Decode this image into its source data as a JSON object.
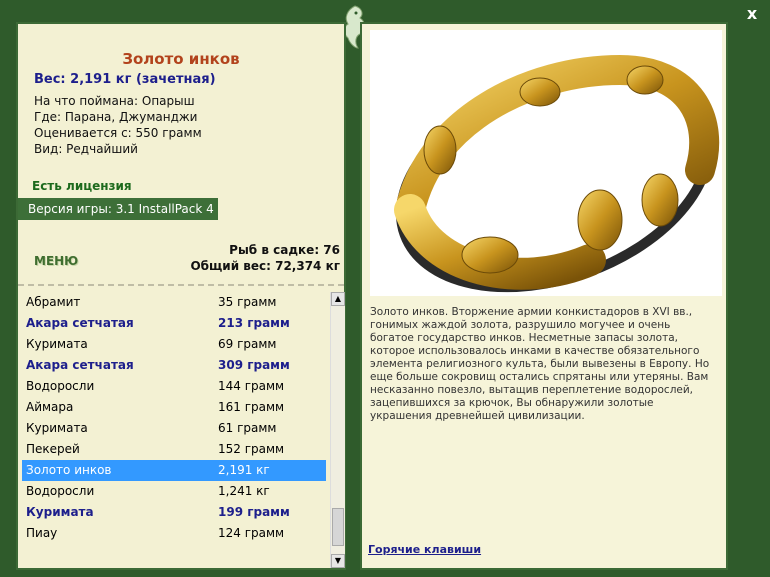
{
  "window": {
    "close_label": "x"
  },
  "fish": {
    "title": "Золото инков",
    "weight_line": "Вес: 2,191 кг (зачетная)",
    "caught_on": "На что поймана: Опарыш",
    "where": "Где: Парана, Джуманджи",
    "valued_from": "Оценивается с: 550 грамм",
    "kind": "Вид: Редчайший"
  },
  "license": "Есть лицензия",
  "version": "Версия игры: 3.1 InstallPack 4",
  "menu_label": "МЕНЮ",
  "stats": {
    "fish_in_keepnet": "Рыб в садке: 76",
    "total_weight": "Общий вес: 72,374 кг"
  },
  "catch_list": [
    {
      "name": "Абрамит",
      "weight": "35 грамм",
      "bold": false,
      "selected": false
    },
    {
      "name": "Акара сетчатая",
      "weight": "213 грамм",
      "bold": true,
      "selected": false
    },
    {
      "name": "Куримата",
      "weight": "69 грамм",
      "bold": false,
      "selected": false
    },
    {
      "name": "Акара сетчатая",
      "weight": "309 грамм",
      "bold": true,
      "selected": false
    },
    {
      "name": "Водоросли",
      "weight": "144 грамм",
      "bold": false,
      "selected": false
    },
    {
      "name": "Аймара",
      "weight": "161 грамм",
      "bold": false,
      "selected": false
    },
    {
      "name": "Куримата",
      "weight": "61 грамм",
      "bold": false,
      "selected": false
    },
    {
      "name": "Пекерей",
      "weight": "152 грамм",
      "bold": false,
      "selected": false
    },
    {
      "name": "Золото инков",
      "weight": "2,191 кг",
      "bold": false,
      "selected": true
    },
    {
      "name": "Водоросли",
      "weight": "1,241 кг",
      "bold": false,
      "selected": false
    },
    {
      "name": "Куримата",
      "weight": "199 грамм",
      "bold": true,
      "selected": false
    },
    {
      "name": "Пиау",
      "weight": "124 грамм",
      "bold": false,
      "selected": false
    }
  ],
  "description": "Золото инков. Вторжение армии конкистадоров в XVI вв., гонимых жаждой золота, разрушило могучее и очень богатое государство инков. Несметные запасы золота, которое использовалось инками в качестве обязательного элемента религиозного культа, были вывезены в Европу. Но еще больше сокровищ остались спрятаны или утеряны. Вам несказанно повезло, вытащив переплетение водорослей, зацепившихся за крючок, Вы обнаружили золотые украшения древнейшей цивилизации.",
  "hotkeys_label": "Горячие клавиши",
  "colors": {
    "frame": "#2f5b2b",
    "panel": "#f3f1d3",
    "title": "#b2431c",
    "accent": "#1d1f8c",
    "selected": "#3399ff"
  },
  "icons": {
    "close": "close-icon",
    "logo": "dragon-logo-icon",
    "photo": "gold-bracelet-image"
  }
}
